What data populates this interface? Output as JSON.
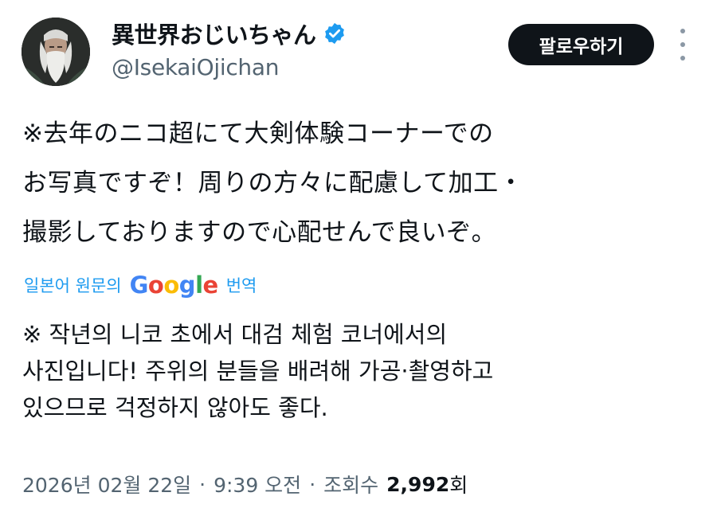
{
  "author": {
    "display_name": "異世界おじいちゃん",
    "handle": "@IsekaiOjichan",
    "verified": true,
    "avatar_icon": "avatar-photo"
  },
  "actions": {
    "follow_label": "팔로우하기",
    "more_icon": "more-vertical-icon"
  },
  "tweet": {
    "lines": [
      "※去年のニコ超にて大剣体験コーナーでの",
      "お写真ですぞ！周りの方々に配慮して加工・",
      "撮影しておりますので心配せんで良いぞ。"
    ]
  },
  "translation": {
    "source_label": "일본어 원문의",
    "provider": "Google",
    "action_label": "번역",
    "lines": [
      "※ 작년의 니코 초에서 대검 체험 코너에서의",
      "사진입니다! 주위의 분들을 배려해 가공·촬영하고",
      "있으므로 걱정하지 않아도 좋다."
    ]
  },
  "meta": {
    "date": "2026년 02월 22일",
    "separator": "·",
    "time": "9:39 오전",
    "views_label": "조회수",
    "views_count": "2,992",
    "views_unit": "회"
  },
  "colors": {
    "accent": "#1d9bf0",
    "text": "#0f1419",
    "secondary": "#536471",
    "button_bg": "#0f1419"
  }
}
